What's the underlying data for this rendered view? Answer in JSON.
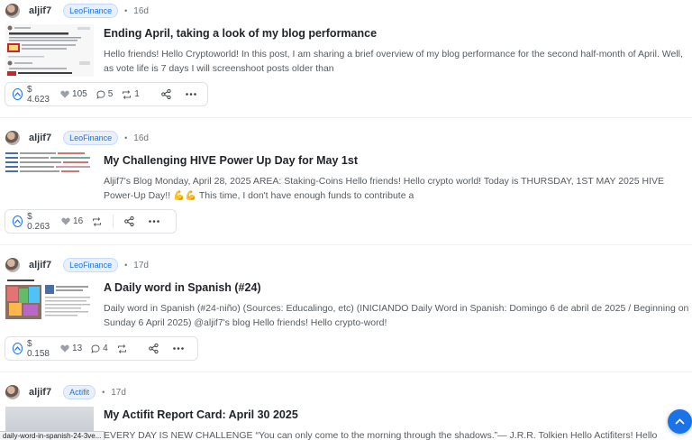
{
  "posts": [
    {
      "author": "aljif7",
      "community": "LeoFinance",
      "age": "16d",
      "title": "Ending April, taking a look of my blog performance",
      "excerpt": "Hello friends! Hello Cryptoworld! In this post, I am sharing a brief overview of my blog performance for the second half-month of April. Well, as vote life is 7 days I will screenshoot posts older than",
      "payout": "$ 4.623",
      "likes": "105",
      "comments": "5",
      "reblogs": "1"
    },
    {
      "author": "aljif7",
      "community": "LeoFinance",
      "age": "16d",
      "title": "My Challenging HIVE Power Up Day for May 1st",
      "excerpt": "Aljif7's Blog Monday, April 28, 2025 AREA: Staking-Coins Hello friends! Hello crypto world! Today is THURSDAY, 1ST MAY 2025 HIVE Power-Up Day!! 💪💪 This time, I don't have enough funds to contribute a",
      "payout": "$ 0.263",
      "likes": "16",
      "comments": "",
      "reblogs": ""
    },
    {
      "author": "aljif7",
      "community": "LeoFinance",
      "age": "17d",
      "title": "A Daily word in Spanish (#24)",
      "excerpt": "Daily word in Spanish (#24-niño) (Sources: Educalingo, etc) (INICIANDO Daily Word in Spanish: Domingo 6 de abril de 2025 / Beginning on Sunday 6 April 2025) @aljif7's blog Hello friends! Hello crypto-word!",
      "payout": "$ 0.158",
      "likes": "13",
      "comments": "4",
      "reblogs": ""
    },
    {
      "author": "aljif7",
      "community": "Actifit",
      "age": "17d",
      "title": "My Actifit Report Card: April 30 2025",
      "excerpt": "EVERY DAY IS NEW CHALLENGE “You can only come to the morning through the shadows.”— J.R.R. Tolkien Hello Actifiters! Hello"
    }
  ],
  "separator": "•",
  "thumb_texts": {
    "post1_heading": "La celebración de la resurrección y el renacimiento"
  },
  "status_url": "daily-word-in-spanish-24-3ve...",
  "colors": {
    "accent": "#1a73e8",
    "badge_bg": "#e8f0fe"
  }
}
